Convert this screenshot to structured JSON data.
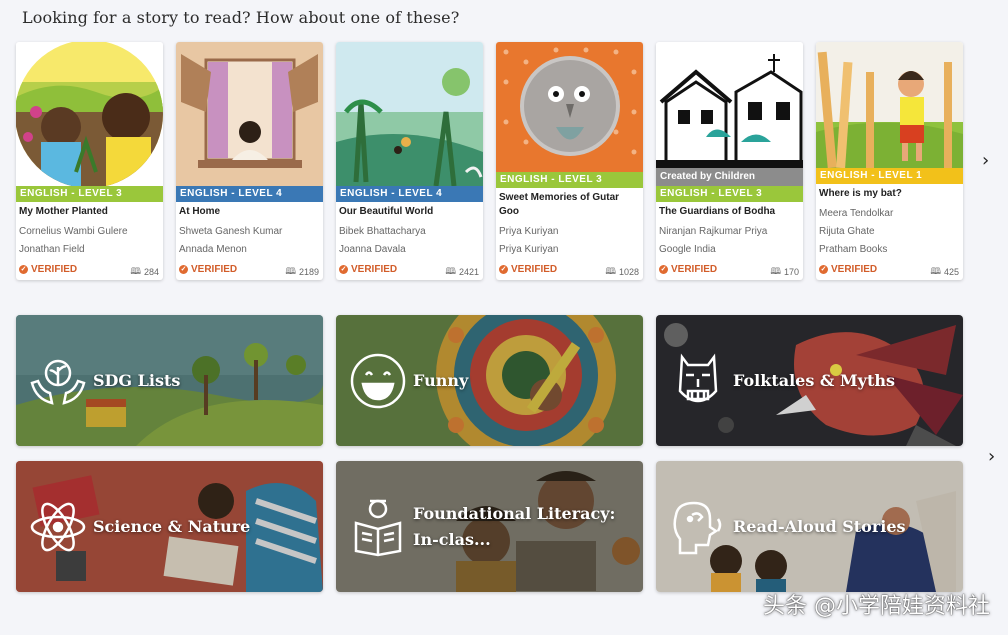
{
  "heading": "Looking for a story to read? How about one of these?",
  "icons": {
    "next_books": "chevron-right-icon",
    "next_categories": "chevron-right-icon",
    "verified": "check-badge-icon",
    "reads": "book-icon"
  },
  "colors": {
    "level3": "#9ac73b",
    "level4": "#3a78b5",
    "level1": "#f2c11a",
    "verified": "#d25d2a"
  },
  "stories": [
    {
      "level": "ENGLISH - LEVEL 3",
      "title": "My Mother Planted",
      "author": "Cornelius Wambi Gulere",
      "illustrator": "Jonathan Field",
      "verified": "VERIFIED",
      "reads": "284"
    },
    {
      "level": "ENGLISH - LEVEL 4",
      "title": "At Home",
      "author": "Shweta Ganesh Kumar",
      "illustrator": "Annada Menon",
      "verified": "VERIFIED",
      "reads": "2189"
    },
    {
      "level": "ENGLISH - LEVEL 4",
      "title": "Our Beautiful World",
      "author": "Bibek Bhattacharya",
      "illustrator": "Joanna Davala",
      "verified": "VERIFIED",
      "reads": "2421"
    },
    {
      "level": "ENGLISH - LEVEL 3",
      "title": "Sweet Memories of Gutar Goo",
      "author": "Priya Kuriyan",
      "illustrator": "Priya Kuriyan",
      "verified": "VERIFIED",
      "reads": "1028"
    },
    {
      "created": "Created by Children",
      "level": "ENGLISH - LEVEL 3",
      "title": "The Guardians of Bodha",
      "author": "Niranjan Rajkumar Priya",
      "illustrator": "Google India",
      "verified": "VERIFIED",
      "reads": "170"
    },
    {
      "level": "ENGLISH - LEVEL 1",
      "title": "Where is my bat?",
      "author": "Meera Tendolkar",
      "illustrator": "Rijuta Ghate",
      "publisher": "Pratham Books",
      "verified": "VERIFIED",
      "reads": "425"
    }
  ],
  "categories": [
    {
      "label": "SDG Lists",
      "icon": "plant-hands-icon"
    },
    {
      "label": "Funny",
      "icon": "smiley-icon"
    },
    {
      "label": "Folktales & Myths",
      "icon": "mask-icon"
    },
    {
      "label": "Science & Nature",
      "icon": "atom-icon"
    },
    {
      "label": "Foundational Literacy: In-clas...",
      "icon": "reader-icon"
    },
    {
      "label": "Read-Aloud Stories",
      "icon": "speaking-head-icon"
    }
  ],
  "watermark": "头条 @小学陪娃资料社"
}
